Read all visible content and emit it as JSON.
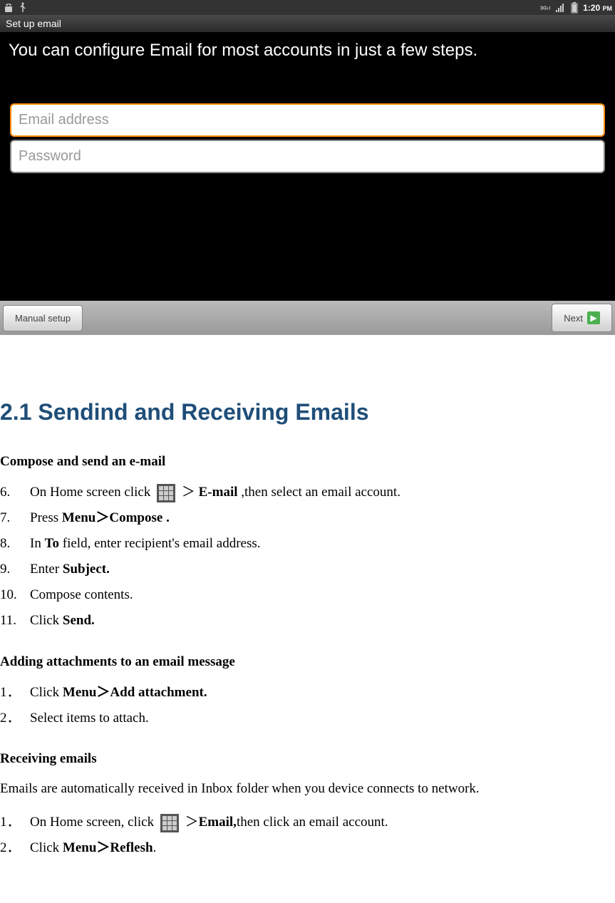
{
  "statusbar": {
    "time": "1:20",
    "ampm": "PM"
  },
  "screenshot": {
    "titlebar": "Set up email",
    "heading": "You can configure Email for most accounts in just a few steps.",
    "email_placeholder": "Email address",
    "password_placeholder": "Password",
    "manual_setup": "Manual setup",
    "next": "Next"
  },
  "section": {
    "heading": "2.1 Sendind and Receiving Emails"
  },
  "compose": {
    "heading": "Compose and send an e-mail",
    "items": {
      "n6": "6.",
      "t6a": "On Home screen click ",
      "t6b": " ＞ ",
      "t6c": "E-mail",
      "t6d": " ,then select an email account.",
      "n7": "7.",
      "t7a": "Press ",
      "t7b": "Menu＞Compose .",
      "n8": "8.",
      "t8a": "In ",
      "t8b": "To",
      "t8c": " field, enter recipient's email address.",
      "n9": "9.",
      "t9a": "Enter ",
      "t9b": "Subject.",
      "n10": "10.",
      "t10": "Compose contents.",
      "n11": "11.",
      "t11a": "Click ",
      "t11b": "Send."
    }
  },
  "attach": {
    "heading": "Adding attachments to an email message",
    "n1": "1．",
    "t1a": "Click ",
    "t1b": "Menu＞Add attachment.",
    "n2": "2．",
    "t2": "Select items to attach."
  },
  "receive": {
    "heading": "Receiving emails",
    "para": "Emails are automatically received in Inbox folder when you device connects to network.",
    "n1": "1．",
    "t1a": "On Home screen, click ",
    "t1b": " ＞",
    "t1c": "Email,",
    "t1d": "then click an email account.",
    "n2": "2．",
    "t2a": "Click ",
    "t2b": "Menu＞Reflesh",
    "t2c": "."
  }
}
